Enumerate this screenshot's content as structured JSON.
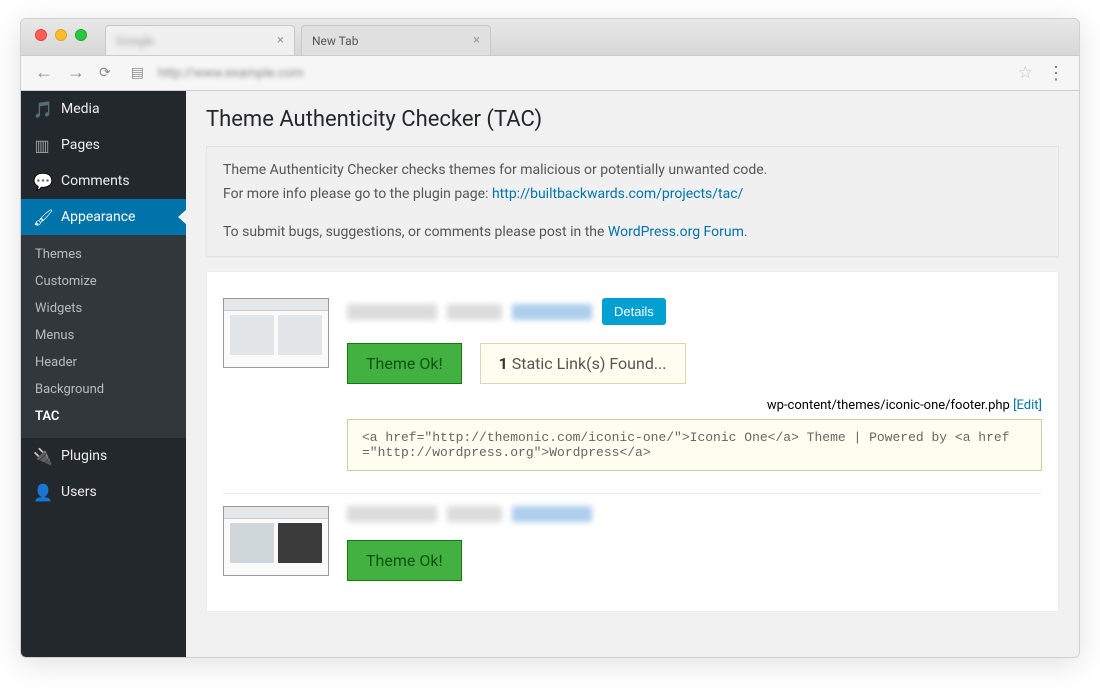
{
  "browser": {
    "tab1_title": "Google",
    "tab2_title": "New Tab",
    "url": "http://www.example.com"
  },
  "sidebar": {
    "media": "Media",
    "pages": "Pages",
    "comments": "Comments",
    "appearance": "Appearance",
    "plugins": "Plugins",
    "users": "Users",
    "sub": {
      "themes": "Themes",
      "customize": "Customize",
      "widgets": "Widgets",
      "menus": "Menus",
      "header": "Header",
      "background": "Background",
      "tac": "TAC"
    }
  },
  "page": {
    "title": "Theme Authenticity Checker (TAC)"
  },
  "notice": {
    "line1": "Theme Authenticity Checker checks themes for malicious or potentially unwanted code.",
    "line2_pre": "For more info please go to the plugin page: ",
    "line2_link": "http://builtbackwards.com/projects/tac/",
    "line3_pre": "To submit bugs, suggestions, or comments please post in the ",
    "line3_link_text": "WordPress.org Forum",
    "period": "."
  },
  "theme1": {
    "details_btn": "Details",
    "status_ok": "Theme Ok!",
    "static_count": "1",
    "static_text": " Static Link(s) Found...",
    "file_path": "wp-content/themes/iconic-one/footer.php ",
    "edit_link": "[Edit]",
    "code": "<a href=\"http://themonic.com/iconic-one/\">Iconic One</a> Theme | Powered by <a href=\"http://wordpress.org\">Wordpress</a>"
  },
  "theme2": {
    "status_ok": "Theme Ok!"
  }
}
